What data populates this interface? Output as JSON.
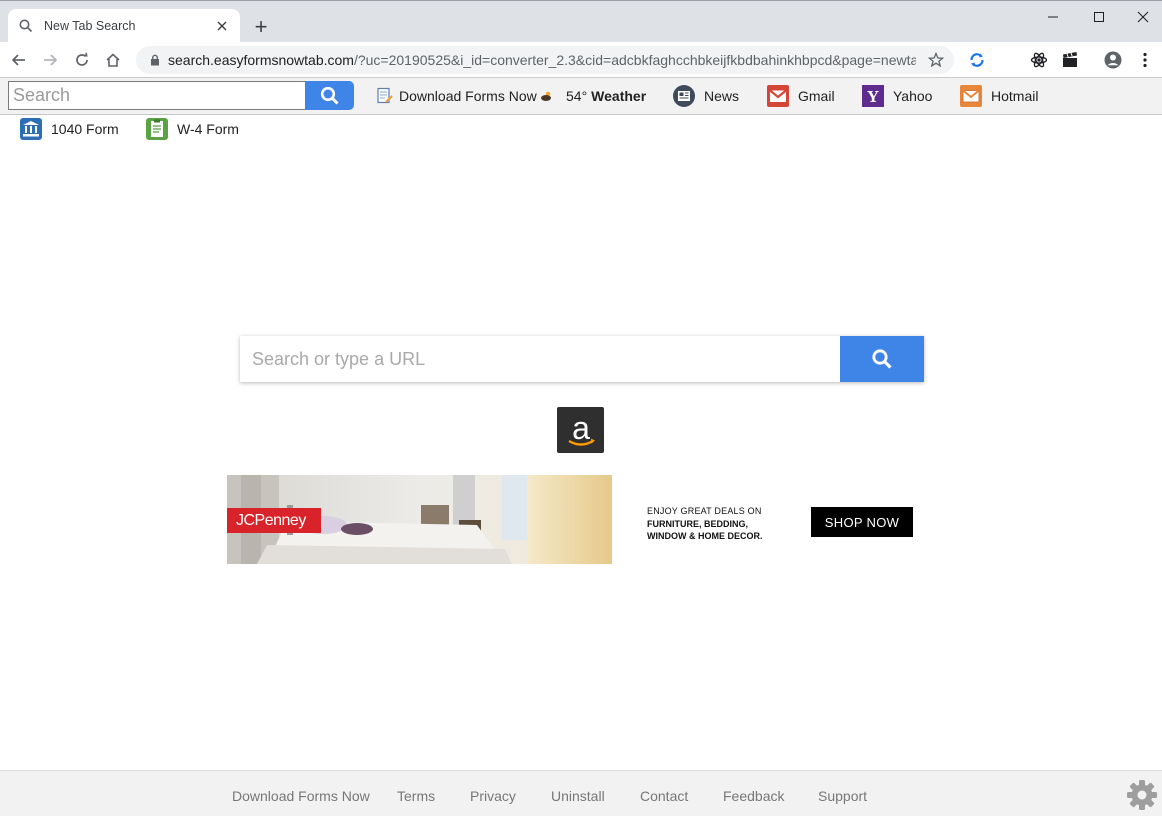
{
  "browser": {
    "tab": {
      "title": "New Tab Search"
    },
    "new_tab_symbol": "+",
    "url": {
      "host": "search.easyformsnowtab.com",
      "rest": "/?uc=20190525&i_id=converter_2.3&cid=adcbkfaghcchbkeijfkbdbahinkhbpcd&page=newta..."
    }
  },
  "extension_bar": {
    "search_placeholder": "Search",
    "links": [
      {
        "label": "Download Forms Now",
        "icon": "document-pen-icon"
      },
      {
        "label": "54°",
        "bold": "Weather",
        "icon": "weather-icon"
      },
      {
        "label": "News",
        "icon": "news-icon"
      },
      {
        "label": "Gmail",
        "icon": "gmail-icon"
      },
      {
        "label": "Yahoo",
        "icon": "yahoo-icon"
      },
      {
        "label": "Hotmail",
        "icon": "hotmail-icon"
      }
    ]
  },
  "quick_links": [
    {
      "label": "1040 Form",
      "icon": "bank-icon"
    },
    {
      "label": "W-4 Form",
      "icon": "clipboard-icon"
    }
  ],
  "main_search": {
    "placeholder": "Search or type a URL"
  },
  "amazon": {
    "glyph": "a"
  },
  "ad": {
    "brand": "JCPenney",
    "line1": "ENJOY GREAT DEALS ON",
    "line2": "FURNITURE, BEDDING,",
    "line3": "WINDOW & HOME DECOR.",
    "cta": "SHOP NOW"
  },
  "footer": {
    "links": [
      "Download Forms Now",
      "Terms",
      "Privacy",
      "Uninstall",
      "Contact",
      "Feedback",
      "Support"
    ]
  },
  "colors": {
    "accent_blue": "#3f84e7",
    "jcp_red": "#d8232a",
    "gmail_red": "#d44638",
    "yahoo_purple": "#5f2b8f",
    "hotmail_orange": "#e8873a"
  }
}
